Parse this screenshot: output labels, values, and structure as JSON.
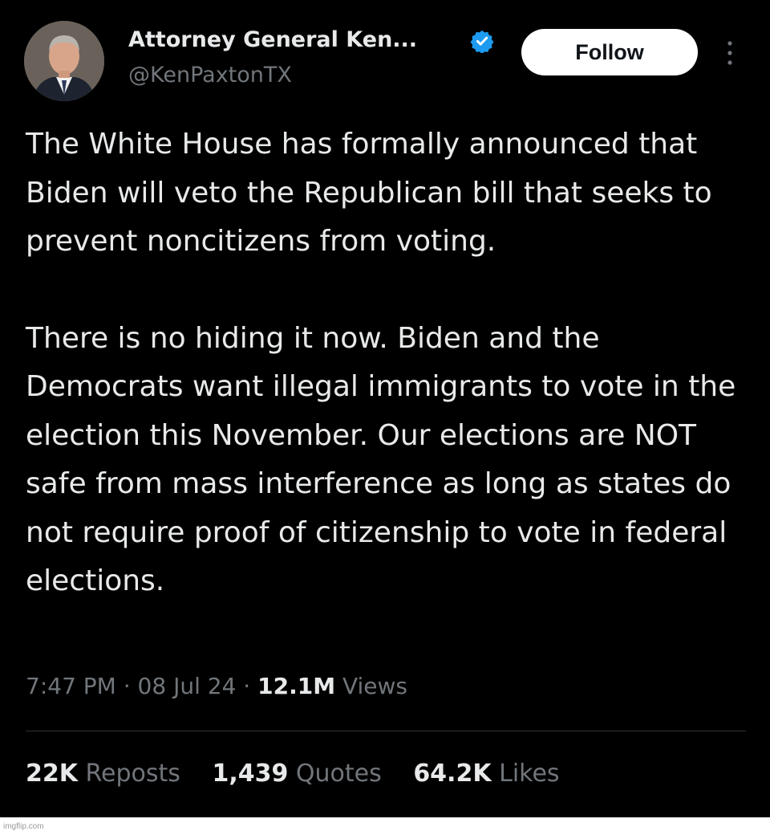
{
  "author": {
    "display_name": "Attorney General Ken...",
    "handle": "@KenPaxtonTX",
    "verified_icon": "verified-badge-icon",
    "verified_color": "#1d9bf0"
  },
  "follow_label": "Follow",
  "more_icon": "more-vertical-icon",
  "body": {
    "paragraph1": "The White House has formally announced that Biden will veto the Republican bill that seeks to prevent noncitizens from voting.",
    "paragraph2": "There is no hiding it now. Biden and the Democrats want illegal immigrants to vote in the election this November. Our elections are NOT safe from mass interference as long as states do not require proof of citizenship to vote in federal elections."
  },
  "meta": {
    "time": "7:47 PM",
    "date": "08 Jul 24",
    "views_count": "12.1M",
    "views_label": "Views"
  },
  "stats": {
    "reposts_count": "22K",
    "reposts_label": "Reposts",
    "quotes_count": "1,439",
    "quotes_label": "Quotes",
    "likes_count": "64.2K",
    "likes_label": "Likes"
  },
  "watermark": "imgflip.com",
  "colors": {
    "background": "#000000",
    "text": "#e7e9ea",
    "secondary": "#71767b",
    "divider": "#2f3336"
  }
}
